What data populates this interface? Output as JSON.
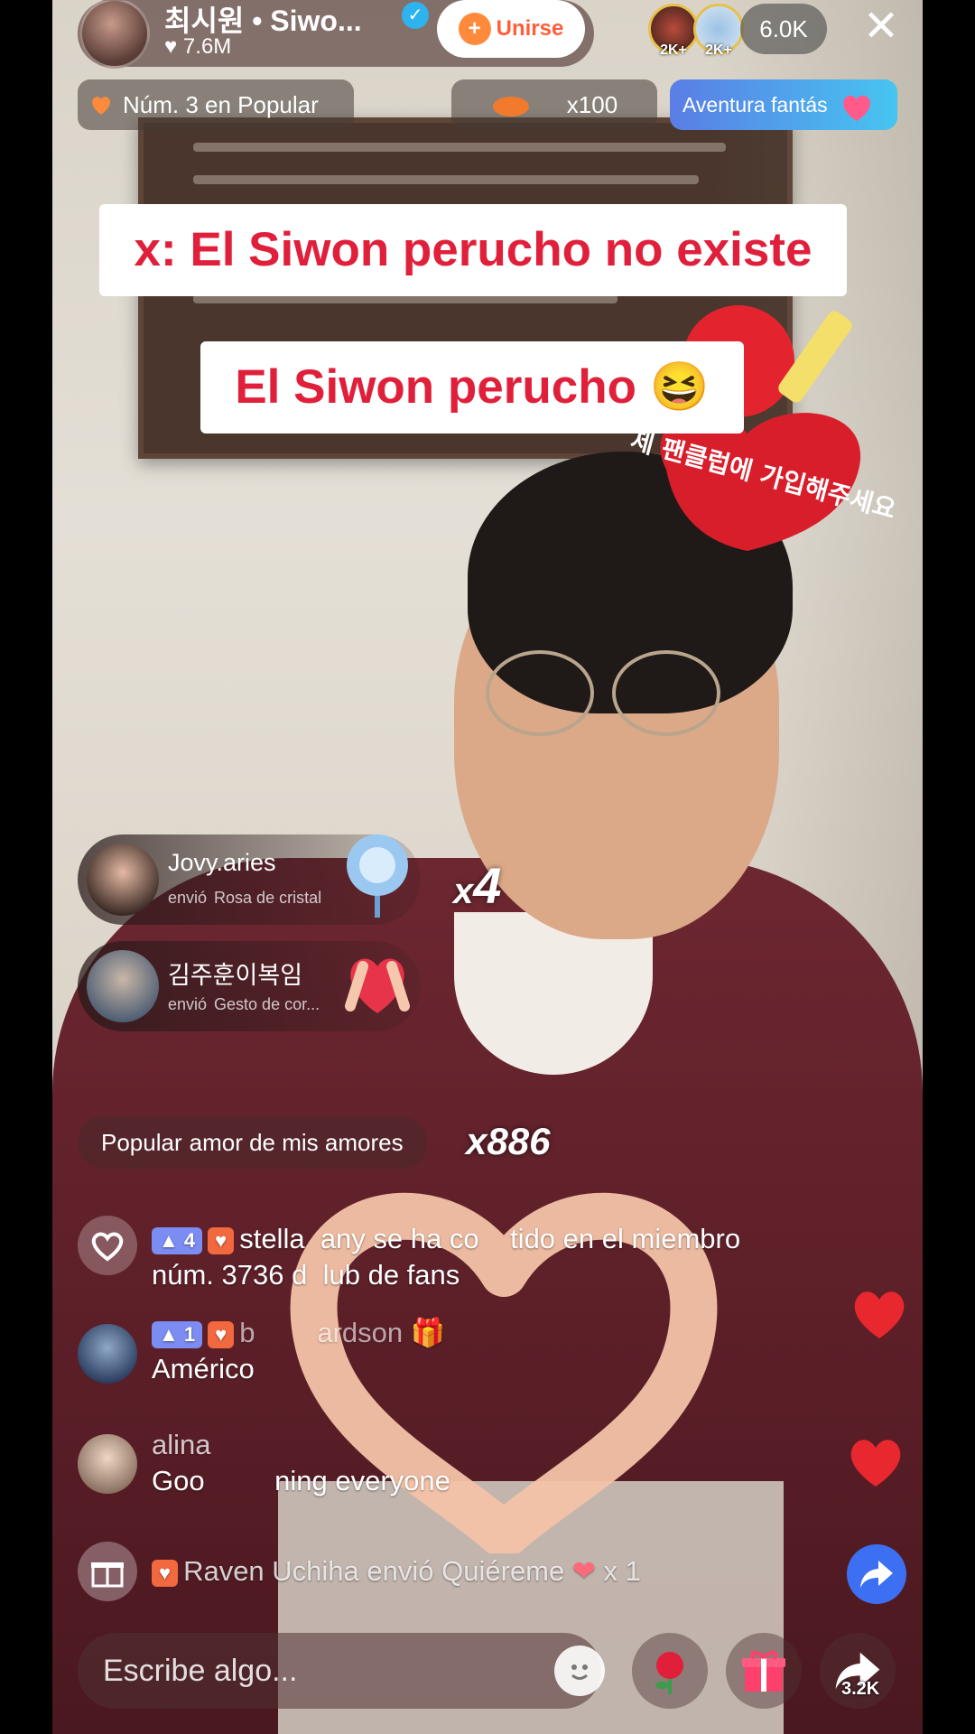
{
  "host": {
    "name": "최시원 • Siwo...",
    "likes": "7.6M",
    "join_label": "Unirse"
  },
  "viewers": {
    "badges": [
      "2K+",
      "2K+"
    ],
    "count": "6.0K"
  },
  "chips": {
    "ranking": "Núm. 3 en Popular",
    "multiplier": "x100",
    "adventure": "Aventura fantás"
  },
  "captions": {
    "line1": "x: El Siwon perucho no existe",
    "line2": "El Siwon perucho 😆"
  },
  "sticker_text": "제 팬클럽에 가입해주세요",
  "gifts": [
    {
      "user": "Jovy.aries",
      "verb": "envió",
      "gift": "Rosa de cristal",
      "count": "4"
    },
    {
      "user": "김주훈이복임",
      "verb": "envió",
      "gift": "Gesto de cor..."
    }
  ],
  "popular": {
    "label": "Popular",
    "title": "amor de mis amores",
    "count": "x886"
  },
  "chat": [
    {
      "level": "4",
      "text1": "stella",
      "text2": "any se ha co",
      "text3": "tido en el miembro",
      "text4": "núm. 3736 d",
      "text5": "lub de fans"
    },
    {
      "level": "1",
      "user_a": "b",
      "user_b": "ardson",
      "msg": "Américo"
    },
    {
      "user": "alina",
      "msg_a": "Goo",
      "msg_b": "ning everyone"
    }
  ],
  "gift_event": {
    "user": "Raven Uchiha",
    "verb": "envió",
    "gift": "Quiéreme",
    "count": "x 1"
  },
  "bottom": {
    "placeholder": "Escribe algo...",
    "share_count": "3.2K"
  },
  "colors": {
    "caption_red": "#e0203b",
    "join_orange": "#ff5e3a",
    "like_red": "#e8272f",
    "share_blue": "#3d6ff3"
  }
}
